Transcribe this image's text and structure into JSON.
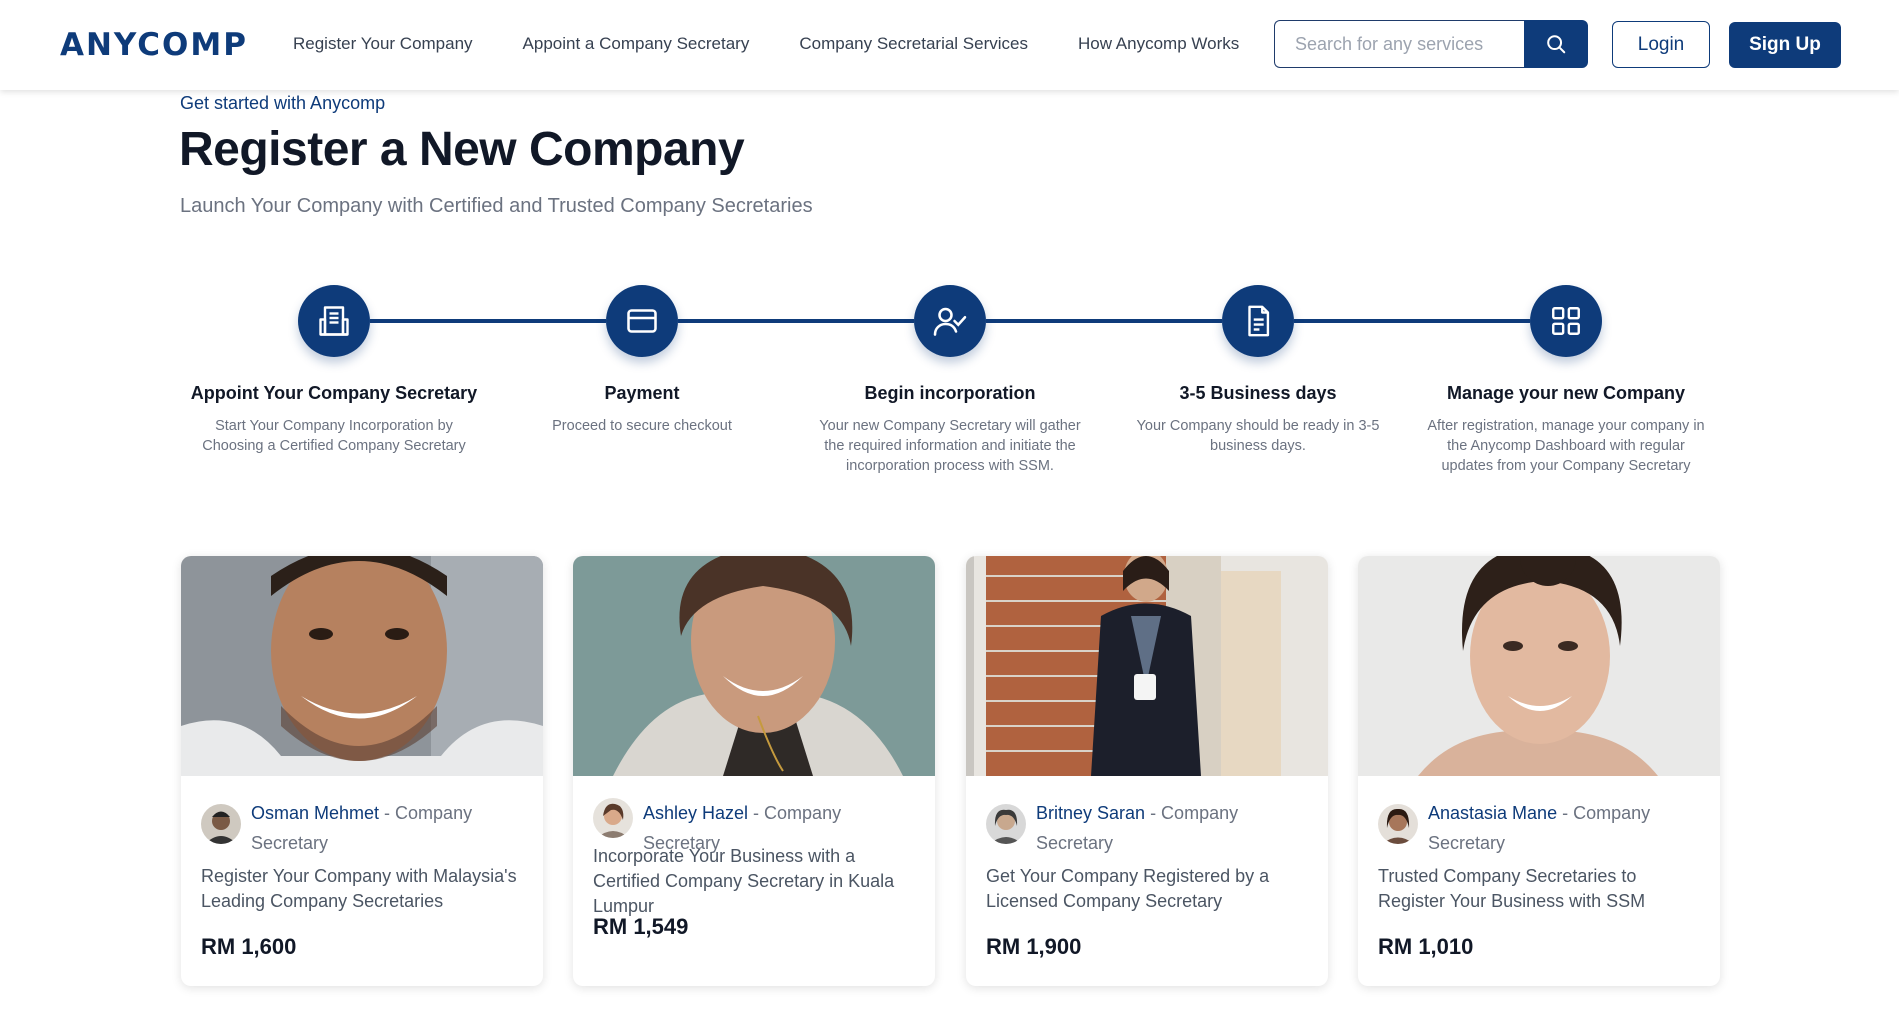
{
  "header": {
    "logo": "ANYCOMP",
    "nav": [
      "Register Your Company",
      "Appoint a Company Secretary",
      "Company Secretarial Services",
      "How Anycomp Works"
    ],
    "search_placeholder": "Search for any services",
    "login_label": "Login",
    "signup_label": "Sign Up"
  },
  "hero": {
    "eyebrow": "Get started with Anycomp",
    "title": "Register a New Company",
    "subtitle": "Launch Your Company with Certified and Trusted Company Secretaries"
  },
  "steps": [
    {
      "icon": "building-icon",
      "title": "Appoint Your Company Secretary",
      "desc": "Start Your Company Incorporation by Choosing a Certified Company Secretary"
    },
    {
      "icon": "credit-card-icon",
      "title": "Payment",
      "desc": "Proceed to secure checkout"
    },
    {
      "icon": "user-check-icon",
      "title": "Begin incorporation",
      "desc": "Your new Company Secretary will gather the required information and initiate the incorporation process with SSM."
    },
    {
      "icon": "document-icon",
      "title": "3-5 Business days",
      "desc": "Your Company should be ready in 3-5 business days."
    },
    {
      "icon": "dashboard-icon",
      "title": "Manage your new Company",
      "desc": "After registration, manage your company in the Anycomp Dashboard with regular updates from your Company Secretary"
    }
  ],
  "cards": [
    {
      "name": "Osman Mehmet",
      "role": " - Company Secretary",
      "desc": "Register Your Company with Malaysia's Leading Company Secretaries",
      "price": "RM 1,600"
    },
    {
      "name": "Ashley Hazel",
      "role": " - Company Secretary",
      "desc": "Incorporate Your Business with a Certified Company Secretary in Kuala Lumpur",
      "price": "RM 1,549"
    },
    {
      "name": "Britney Saran",
      "role": " - Company Secretary",
      "desc": "Get Your Company Registered by a Licensed Company Secretary",
      "price": "RM 1,900"
    },
    {
      "name": "Anastasia Mane",
      "role": " - Company Secretary",
      "desc": "Trusted Company Secretaries to Register Your Business with SSM",
      "price": "RM 1,010"
    }
  ],
  "colors": {
    "brand": "#0e3b7a",
    "text": "#111827",
    "muted": "#6b7280"
  }
}
